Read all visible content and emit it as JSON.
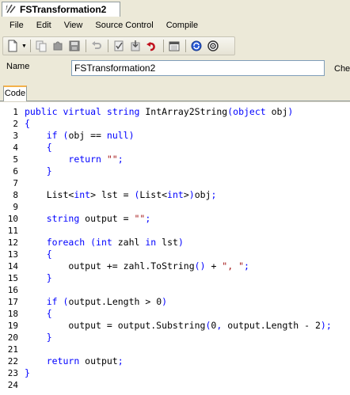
{
  "document_tab": {
    "title": "FSTransformation2",
    "icon": "transformation-icon"
  },
  "menu": [
    "File",
    "Edit",
    "View",
    "Source Control",
    "Compile"
  ],
  "toolbar": {
    "buttons": [
      "new-icon",
      "copy-icon",
      "puzzle-icon",
      "save-icon",
      "undo-icon",
      "check-icon",
      "check-in-icon",
      "refresh-icon",
      "calendar-icon",
      "sync-icon",
      "target-icon"
    ]
  },
  "name_field": {
    "label": "Name",
    "value": "FSTransformation2",
    "trailing_label": "Che"
  },
  "code_tab": {
    "label": "Code"
  },
  "code": {
    "line_numbers": [
      "1",
      "2",
      "3",
      "4",
      "5",
      "6",
      "7",
      "8",
      "9",
      "10",
      "11",
      "12",
      "13",
      "14",
      "15",
      "16",
      "17",
      "18",
      "19",
      "20",
      "21",
      "22",
      "23",
      "24"
    ],
    "lines": [
      "public virtual string IntArray2String(object obj)",
      "{",
      "    if (obj == null)",
      "    {",
      "        return \"\";",
      "    }",
      "",
      "    List<int> lst = (List<int>)obj;",
      "",
      "    string output = \"\";",
      "",
      "    foreach (int zahl in lst)",
      "    {",
      "        output += zahl.ToString() + \", \";",
      "    }",
      "",
      "    if (output.Length > 0)",
      "    {",
      "        output = output.Substring(0, output.Length - 2);",
      "    }",
      "",
      "    return output;",
      "}",
      ""
    ]
  },
  "colors": {
    "keyword": "#0000ff",
    "string": "#a31515",
    "tab_accent": "#f4b14a"
  }
}
